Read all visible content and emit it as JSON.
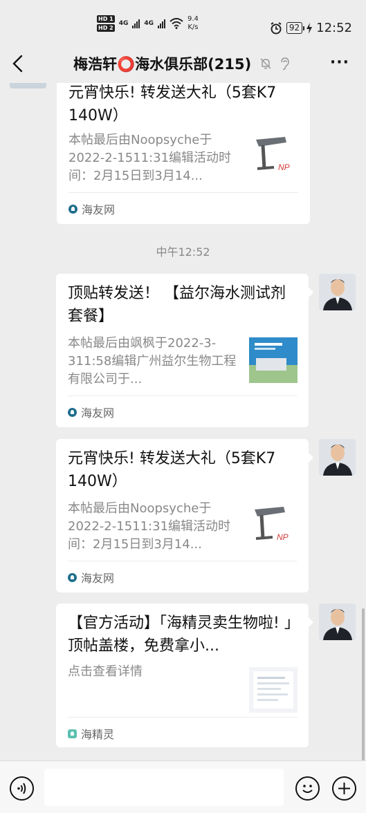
{
  "status_bar": {
    "sim1": "HD 1",
    "sim2": "HD 2",
    "signal1": "4G",
    "signal2": "4G",
    "speed_value": "9.4",
    "speed_unit": "K/s",
    "battery": "92",
    "time": "12:52"
  },
  "header": {
    "title": "梅浩轩⭕海水俱乐部(215)",
    "more": "···"
  },
  "messages": [
    {
      "title": "元宵快乐! 转发送大礼（5套K7 140W）",
      "desc": "本帖最后由Noopsyche于2022-2-1511:31编辑活动时间：2月15日到3月14...",
      "source": "海友网"
    },
    {
      "title": "顶贴转发送！ 【益尔海水测试剂套餐】",
      "desc": "本帖最后由飒枫于2022-3-311:58编辑广州益尔生物工程有限公司于...",
      "source": "海友网"
    },
    {
      "title": "元宵快乐! 转发送大礼（5套K7 140W）",
      "desc": "本帖最后由Noopsyche于2022-2-1511:31编辑活动时间：2月15日到3月14...",
      "source": "海友网"
    },
    {
      "title": "【官方活动】「海精灵卖生物啦! 」顶帖盖楼，免费拿小...",
      "desc": "点击查看详情",
      "source": "海精灵"
    }
  ],
  "timestamp": "中午12:52",
  "icons": {
    "back": "back-arrow-icon",
    "mute": "bell-muted-icon",
    "ear": "earpiece-icon",
    "voice": "voice-icon",
    "emoji": "emoji-icon",
    "plus": "plus-icon"
  }
}
